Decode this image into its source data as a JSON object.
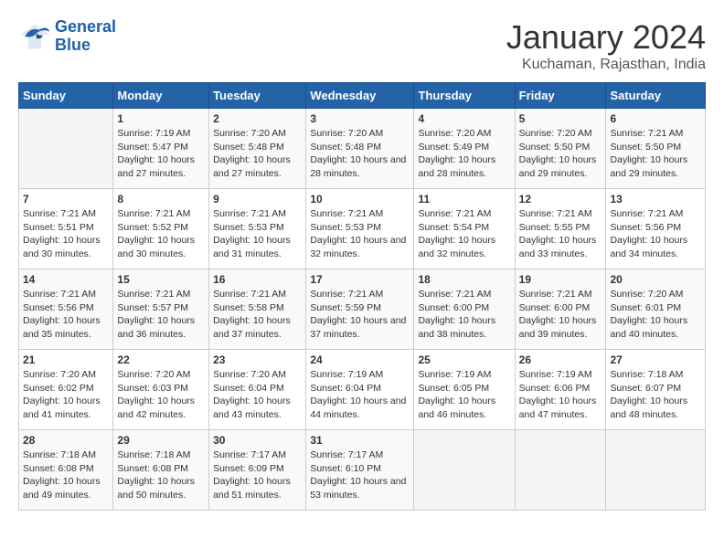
{
  "header": {
    "logo_line1": "General",
    "logo_line2": "Blue",
    "month": "January 2024",
    "location": "Kuchaman, Rajasthan, India"
  },
  "days_of_week": [
    "Sunday",
    "Monday",
    "Tuesday",
    "Wednesday",
    "Thursday",
    "Friday",
    "Saturday"
  ],
  "weeks": [
    [
      {
        "day": "",
        "empty": true
      },
      {
        "day": "1",
        "sunrise": "Sunrise: 7:19 AM",
        "sunset": "Sunset: 5:47 PM",
        "daylight": "Daylight: 10 hours and 27 minutes."
      },
      {
        "day": "2",
        "sunrise": "Sunrise: 7:20 AM",
        "sunset": "Sunset: 5:48 PM",
        "daylight": "Daylight: 10 hours and 27 minutes."
      },
      {
        "day": "3",
        "sunrise": "Sunrise: 7:20 AM",
        "sunset": "Sunset: 5:48 PM",
        "daylight": "Daylight: 10 hours and 28 minutes."
      },
      {
        "day": "4",
        "sunrise": "Sunrise: 7:20 AM",
        "sunset": "Sunset: 5:49 PM",
        "daylight": "Daylight: 10 hours and 28 minutes."
      },
      {
        "day": "5",
        "sunrise": "Sunrise: 7:20 AM",
        "sunset": "Sunset: 5:50 PM",
        "daylight": "Daylight: 10 hours and 29 minutes."
      },
      {
        "day": "6",
        "sunrise": "Sunrise: 7:21 AM",
        "sunset": "Sunset: 5:50 PM",
        "daylight": "Daylight: 10 hours and 29 minutes."
      }
    ],
    [
      {
        "day": "7",
        "sunrise": "Sunrise: 7:21 AM",
        "sunset": "Sunset: 5:51 PM",
        "daylight": "Daylight: 10 hours and 30 minutes."
      },
      {
        "day": "8",
        "sunrise": "Sunrise: 7:21 AM",
        "sunset": "Sunset: 5:52 PM",
        "daylight": "Daylight: 10 hours and 30 minutes."
      },
      {
        "day": "9",
        "sunrise": "Sunrise: 7:21 AM",
        "sunset": "Sunset: 5:53 PM",
        "daylight": "Daylight: 10 hours and 31 minutes."
      },
      {
        "day": "10",
        "sunrise": "Sunrise: 7:21 AM",
        "sunset": "Sunset: 5:53 PM",
        "daylight": "Daylight: 10 hours and 32 minutes."
      },
      {
        "day": "11",
        "sunrise": "Sunrise: 7:21 AM",
        "sunset": "Sunset: 5:54 PM",
        "daylight": "Daylight: 10 hours and 32 minutes."
      },
      {
        "day": "12",
        "sunrise": "Sunrise: 7:21 AM",
        "sunset": "Sunset: 5:55 PM",
        "daylight": "Daylight: 10 hours and 33 minutes."
      },
      {
        "day": "13",
        "sunrise": "Sunrise: 7:21 AM",
        "sunset": "Sunset: 5:56 PM",
        "daylight": "Daylight: 10 hours and 34 minutes."
      }
    ],
    [
      {
        "day": "14",
        "sunrise": "Sunrise: 7:21 AM",
        "sunset": "Sunset: 5:56 PM",
        "daylight": "Daylight: 10 hours and 35 minutes."
      },
      {
        "day": "15",
        "sunrise": "Sunrise: 7:21 AM",
        "sunset": "Sunset: 5:57 PM",
        "daylight": "Daylight: 10 hours and 36 minutes."
      },
      {
        "day": "16",
        "sunrise": "Sunrise: 7:21 AM",
        "sunset": "Sunset: 5:58 PM",
        "daylight": "Daylight: 10 hours and 37 minutes."
      },
      {
        "day": "17",
        "sunrise": "Sunrise: 7:21 AM",
        "sunset": "Sunset: 5:59 PM",
        "daylight": "Daylight: 10 hours and 37 minutes."
      },
      {
        "day": "18",
        "sunrise": "Sunrise: 7:21 AM",
        "sunset": "Sunset: 6:00 PM",
        "daylight": "Daylight: 10 hours and 38 minutes."
      },
      {
        "day": "19",
        "sunrise": "Sunrise: 7:21 AM",
        "sunset": "Sunset: 6:00 PM",
        "daylight": "Daylight: 10 hours and 39 minutes."
      },
      {
        "day": "20",
        "sunrise": "Sunrise: 7:20 AM",
        "sunset": "Sunset: 6:01 PM",
        "daylight": "Daylight: 10 hours and 40 minutes."
      }
    ],
    [
      {
        "day": "21",
        "sunrise": "Sunrise: 7:20 AM",
        "sunset": "Sunset: 6:02 PM",
        "daylight": "Daylight: 10 hours and 41 minutes."
      },
      {
        "day": "22",
        "sunrise": "Sunrise: 7:20 AM",
        "sunset": "Sunset: 6:03 PM",
        "daylight": "Daylight: 10 hours and 42 minutes."
      },
      {
        "day": "23",
        "sunrise": "Sunrise: 7:20 AM",
        "sunset": "Sunset: 6:04 PM",
        "daylight": "Daylight: 10 hours and 43 minutes."
      },
      {
        "day": "24",
        "sunrise": "Sunrise: 7:19 AM",
        "sunset": "Sunset: 6:04 PM",
        "daylight": "Daylight: 10 hours and 44 minutes."
      },
      {
        "day": "25",
        "sunrise": "Sunrise: 7:19 AM",
        "sunset": "Sunset: 6:05 PM",
        "daylight": "Daylight: 10 hours and 46 minutes."
      },
      {
        "day": "26",
        "sunrise": "Sunrise: 7:19 AM",
        "sunset": "Sunset: 6:06 PM",
        "daylight": "Daylight: 10 hours and 47 minutes."
      },
      {
        "day": "27",
        "sunrise": "Sunrise: 7:18 AM",
        "sunset": "Sunset: 6:07 PM",
        "daylight": "Daylight: 10 hours and 48 minutes."
      }
    ],
    [
      {
        "day": "28",
        "sunrise": "Sunrise: 7:18 AM",
        "sunset": "Sunset: 6:08 PM",
        "daylight": "Daylight: 10 hours and 49 minutes."
      },
      {
        "day": "29",
        "sunrise": "Sunrise: 7:18 AM",
        "sunset": "Sunset: 6:08 PM",
        "daylight": "Daylight: 10 hours and 50 minutes."
      },
      {
        "day": "30",
        "sunrise": "Sunrise: 7:17 AM",
        "sunset": "Sunset: 6:09 PM",
        "daylight": "Daylight: 10 hours and 51 minutes."
      },
      {
        "day": "31",
        "sunrise": "Sunrise: 7:17 AM",
        "sunset": "Sunset: 6:10 PM",
        "daylight": "Daylight: 10 hours and 53 minutes."
      },
      {
        "day": "",
        "empty": true
      },
      {
        "day": "",
        "empty": true
      },
      {
        "day": "",
        "empty": true
      }
    ]
  ]
}
